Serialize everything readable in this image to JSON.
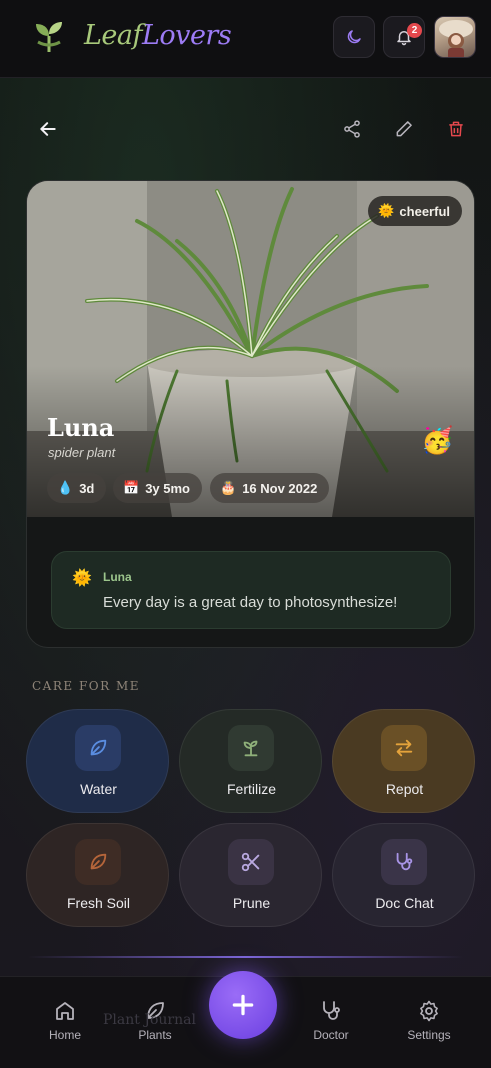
{
  "app": {
    "name_part1": "Leaf",
    "name_part2": "Lovers",
    "notification_count": "2"
  },
  "plant": {
    "name": "Luna",
    "species": "spider plant",
    "mood": "cheerful",
    "stats": [
      {
        "icon": "water-drop-icon",
        "value": "3d"
      },
      {
        "icon": "calendar-icon",
        "value": "3y 5mo"
      },
      {
        "icon": "birthday-cake-icon",
        "value": "16 Nov 2022"
      }
    ],
    "message_author": "Luna",
    "message_text": "Every day is a great day to photosynthesize!"
  },
  "care": {
    "title": "CARE FOR ME",
    "actions": [
      {
        "label": "Water",
        "icon": "leaf-icon",
        "color": "#5a8de0"
      },
      {
        "label": "Fertilize",
        "icon": "sprout-icon",
        "color": "#8fb07a"
      },
      {
        "label": "Repot",
        "icon": "swap-arrows-icon",
        "color": "#e3a23b"
      },
      {
        "label": "Fresh Soil",
        "icon": "leaf-icon",
        "color": "#b5653a"
      },
      {
        "label": "Prune",
        "icon": "scissors-icon",
        "color": "#b9a9e0"
      },
      {
        "label": "Doc Chat",
        "icon": "stethoscope-icon",
        "color": "#a894e6"
      }
    ]
  },
  "nav": {
    "items": [
      {
        "label": "Home",
        "icon": "home-icon"
      },
      {
        "label": "Plants",
        "icon": "leaf-icon"
      },
      {
        "label": "Doctor",
        "icon": "stethoscope-icon"
      },
      {
        "label": "Settings",
        "icon": "gear-icon"
      }
    ],
    "ghost_label": "Plant Journal"
  },
  "colors": {
    "accent": "#7c4dff",
    "danger": "#e5484d",
    "leaf_green": "#a8c97b"
  }
}
